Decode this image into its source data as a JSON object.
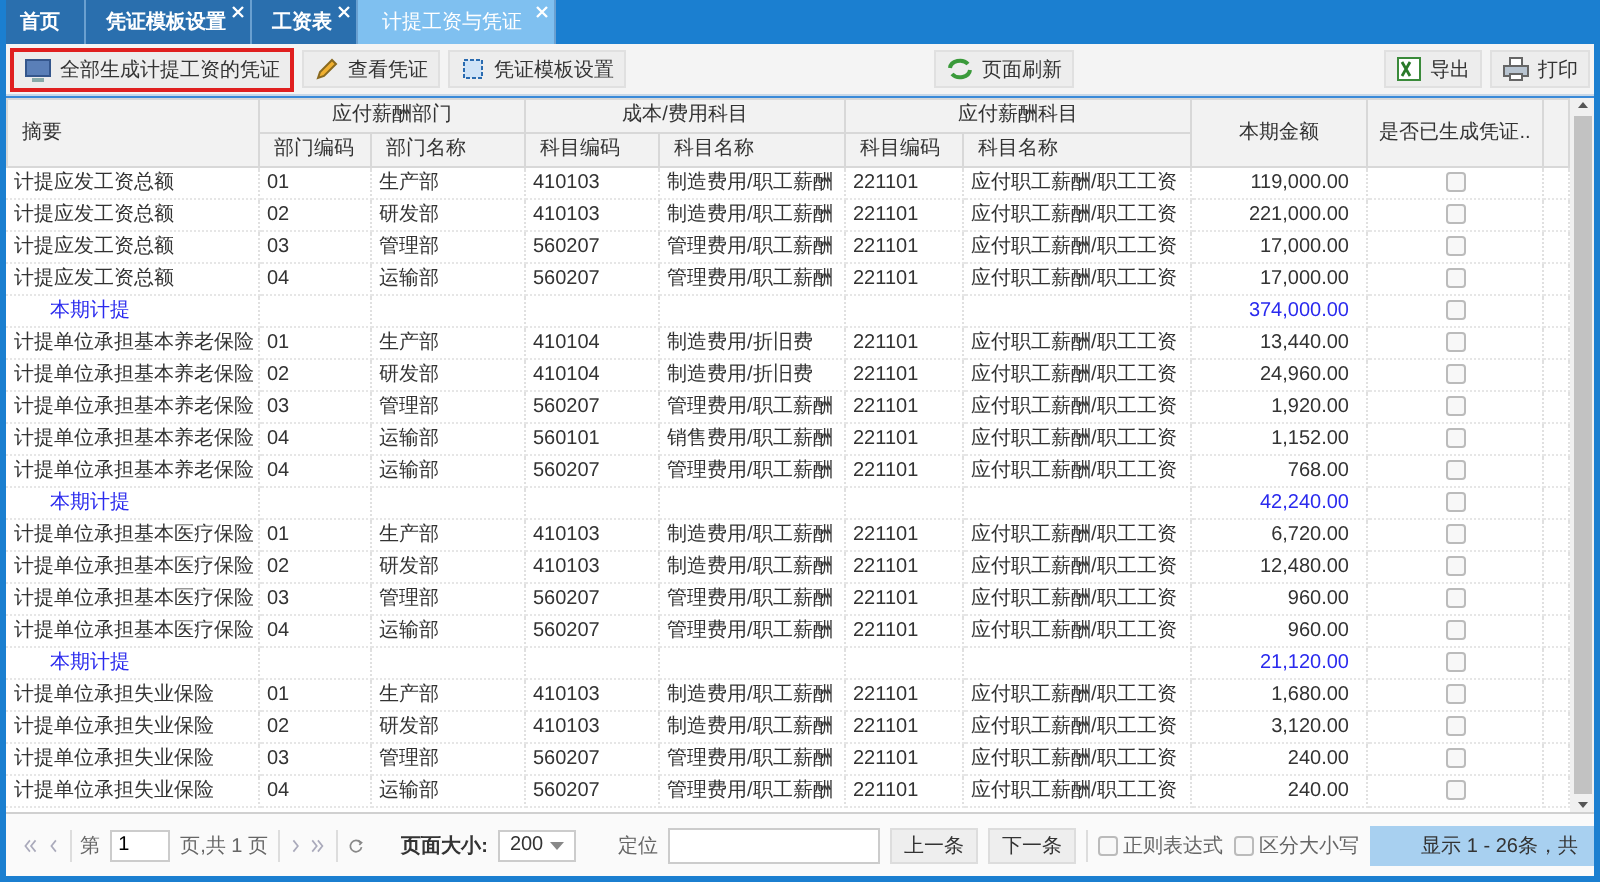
{
  "tabs": [
    {
      "label": "首页",
      "closable": false,
      "selected": false
    },
    {
      "label": "凭证模板设置",
      "closable": true,
      "selected": false
    },
    {
      "label": "工资表",
      "closable": true,
      "selected": false
    },
    {
      "label": "计提工资与凭证",
      "closable": true,
      "selected": true
    }
  ],
  "toolbar": {
    "left": [
      {
        "label": "全部生成计提工资的凭证",
        "highlighted": true
      },
      {
        "label": "查看凭证",
        "highlighted": false
      },
      {
        "label": "凭证模板设置",
        "highlighted": false
      },
      {
        "label": "页面刷新",
        "highlighted": false
      }
    ],
    "right": [
      {
        "label": "导出"
      },
      {
        "label": "打印"
      }
    ]
  },
  "table": {
    "header_groups": [
      "摘要",
      "应付薪酬部门",
      "成本/费用科目",
      "应付薪酬科目",
      "本期金额",
      "是否已生成凭证.."
    ],
    "sub_columns": [
      "部门编码",
      "部门名称",
      "科目编码",
      "科目名称",
      "科目编码",
      "科目名称"
    ],
    "rows": [
      {
        "kind": "detail",
        "cells": [
          "计提应发工资总额",
          "01",
          "生产部",
          "410103",
          "制造费用/职工薪酬",
          "221101",
          "应付职工薪酬/职工工资",
          "119,000.00"
        ],
        "checked": false
      },
      {
        "kind": "detail",
        "cells": [
          "计提应发工资总额",
          "02",
          "研发部",
          "410103",
          "制造费用/职工薪酬",
          "221101",
          "应付职工薪酬/职工工资",
          "221,000.00"
        ],
        "checked": false
      },
      {
        "kind": "detail",
        "cells": [
          "计提应发工资总额",
          "03",
          "管理部",
          "560207",
          "管理费用/职工薪酬",
          "221101",
          "应付职工薪酬/职工工资",
          "17,000.00"
        ],
        "checked": false
      },
      {
        "kind": "detail",
        "cells": [
          "计提应发工资总额",
          "04",
          "运输部",
          "560207",
          "管理费用/职工薪酬",
          "221101",
          "应付职工薪酬/职工工资",
          "17,000.00"
        ],
        "checked": false
      },
      {
        "kind": "subtotal",
        "label": "本期计提",
        "amount": "374,000.00",
        "checked": false
      },
      {
        "kind": "detail",
        "cells": [
          "计提单位承担基本养老保险",
          "01",
          "生产部",
          "410104",
          "制造费用/折旧费",
          "221101",
          "应付职工薪酬/职工工资",
          "13,440.00"
        ],
        "checked": false
      },
      {
        "kind": "detail",
        "cells": [
          "计提单位承担基本养老保险",
          "02",
          "研发部",
          "410104",
          "制造费用/折旧费",
          "221101",
          "应付职工薪酬/职工工资",
          "24,960.00"
        ],
        "checked": false
      },
      {
        "kind": "detail",
        "cells": [
          "计提单位承担基本养老保险",
          "03",
          "管理部",
          "560207",
          "管理费用/职工薪酬",
          "221101",
          "应付职工薪酬/职工工资",
          "1,920.00"
        ],
        "checked": false
      },
      {
        "kind": "detail",
        "cells": [
          "计提单位承担基本养老保险",
          "04",
          "运输部",
          "560101",
          "销售费用/职工薪酬",
          "221101",
          "应付职工薪酬/职工工资",
          "1,152.00"
        ],
        "checked": false
      },
      {
        "kind": "detail",
        "cells": [
          "计提单位承担基本养老保险",
          "04",
          "运输部",
          "560207",
          "管理费用/职工薪酬",
          "221101",
          "应付职工薪酬/职工工资",
          "768.00"
        ],
        "checked": false
      },
      {
        "kind": "subtotal",
        "label": "本期计提",
        "amount": "42,240.00",
        "checked": false
      },
      {
        "kind": "detail",
        "cells": [
          "计提单位承担基本医疗保险",
          "01",
          "生产部",
          "410103",
          "制造费用/职工薪酬",
          "221101",
          "应付职工薪酬/职工工资",
          "6,720.00"
        ],
        "checked": false
      },
      {
        "kind": "detail",
        "cells": [
          "计提单位承担基本医疗保险",
          "02",
          "研发部",
          "410103",
          "制造费用/职工薪酬",
          "221101",
          "应付职工薪酬/职工工资",
          "12,480.00"
        ],
        "checked": false
      },
      {
        "kind": "detail",
        "cells": [
          "计提单位承担基本医疗保险",
          "03",
          "管理部",
          "560207",
          "管理费用/职工薪酬",
          "221101",
          "应付职工薪酬/职工工资",
          "960.00"
        ],
        "checked": false
      },
      {
        "kind": "detail",
        "cells": [
          "计提单位承担基本医疗保险",
          "04",
          "运输部",
          "560207",
          "管理费用/职工薪酬",
          "221101",
          "应付职工薪酬/职工工资",
          "960.00"
        ],
        "checked": false
      },
      {
        "kind": "subtotal",
        "label": "本期计提",
        "amount": "21,120.00",
        "checked": false
      },
      {
        "kind": "detail",
        "cells": [
          "计提单位承担失业保险",
          "01",
          "生产部",
          "410103",
          "制造费用/职工薪酬",
          "221101",
          "应付职工薪酬/职工工资",
          "1,680.00"
        ],
        "checked": false
      },
      {
        "kind": "detail",
        "cells": [
          "计提单位承担失业保险",
          "02",
          "研发部",
          "410103",
          "制造费用/职工薪酬",
          "221101",
          "应付职工薪酬/职工工资",
          "3,120.00"
        ],
        "checked": false
      },
      {
        "kind": "detail",
        "cells": [
          "计提单位承担失业保险",
          "03",
          "管理部",
          "560207",
          "管理费用/职工薪酬",
          "221101",
          "应付职工薪酬/职工工资",
          "240.00"
        ],
        "checked": false
      },
      {
        "kind": "detail",
        "cells": [
          "计提单位承担失业保险",
          "04",
          "运输部",
          "560207",
          "管理费用/职工薪酬",
          "221101",
          "应付职工薪酬/职工工资",
          "240.00"
        ],
        "checked": false
      }
    ]
  },
  "pager": {
    "page_label": "第",
    "page": "1",
    "page_total": "页,共 1 页",
    "size_label": "页面大小:",
    "size": "200",
    "locate_label": "定位",
    "prev": "上一条",
    "next": "下一条",
    "options": [
      {
        "label": "正则表达式",
        "checked": false
      },
      {
        "label": "区分大小写",
        "checked": false
      }
    ],
    "status": "显示 1 - 26条，共"
  }
}
